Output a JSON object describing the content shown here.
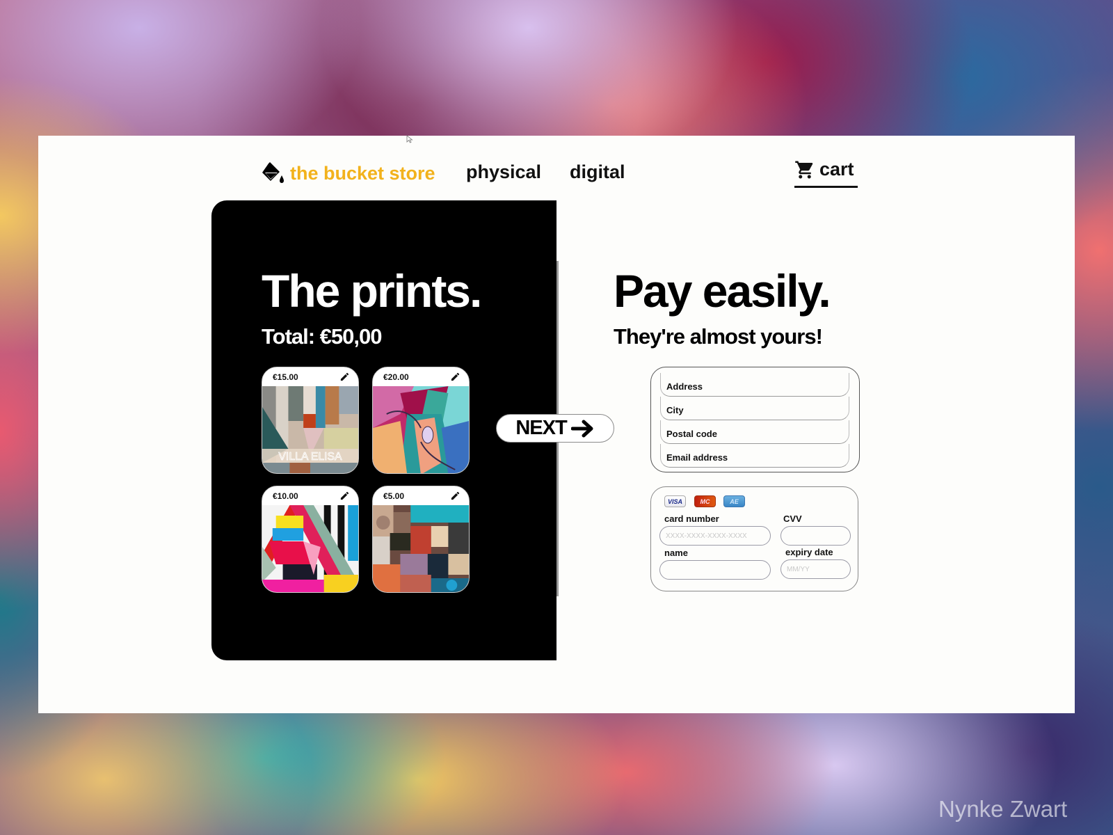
{
  "nav": {
    "brand_label": "the bucket store",
    "brand_color": "#f2b21c",
    "brand_icon": "paint-bucket-icon",
    "links": [
      {
        "label": "physical"
      },
      {
        "label": "digital"
      }
    ],
    "cart_label": "cart",
    "cart_icon": "shopping-cart-icon"
  },
  "prints": {
    "title": "The prints.",
    "total": "Total: €50,00",
    "items": [
      {
        "price": "€15.00",
        "edit_icon": "pencil-icon",
        "art_text": "VILLA ELISA"
      },
      {
        "price": "€20.00",
        "edit_icon": "pencil-icon"
      },
      {
        "price": "€10.00",
        "edit_icon": "pencil-icon"
      },
      {
        "price": "€5.00",
        "edit_icon": "pencil-icon"
      }
    ]
  },
  "next_button": {
    "label": "NEXT",
    "icon": "arrow-right-icon"
  },
  "payment": {
    "title": "Pay easily.",
    "subtitle": "They're almost yours!",
    "address_fields": [
      {
        "placeholder": "Address",
        "value": ""
      },
      {
        "placeholder": "City",
        "value": ""
      },
      {
        "placeholder": "Postal code",
        "value": ""
      },
      {
        "placeholder": "Email address",
        "value": ""
      }
    ],
    "card_brands": [
      "VISA",
      "MC",
      "AE"
    ],
    "card": {
      "card_number_label": "card number",
      "card_number_placeholder": "XXXX-XXXX-XXXX-XXXX",
      "cvv_label": "CVV",
      "cvv_placeholder": "",
      "name_label": "name",
      "name_placeholder": "",
      "expiry_label": "expiry date",
      "expiry_placeholder": "MM/YY"
    }
  },
  "watermark": "Nynke Zwart"
}
